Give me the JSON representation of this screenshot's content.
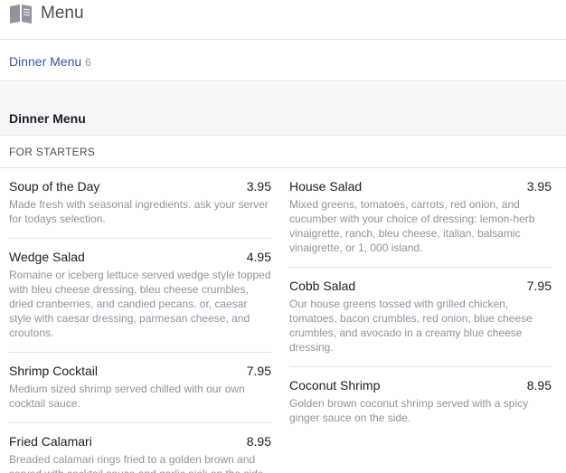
{
  "header": {
    "title": "Menu",
    "icon": "book-icon"
  },
  "tabs": [
    {
      "label": "Dinner Menu",
      "count": "6"
    }
  ],
  "section": {
    "title": "Dinner Menu",
    "subtitle": "FOR STARTERS"
  },
  "left_items": [
    {
      "name": "Soup of the Day",
      "price": "3.95",
      "desc": "Made fresh with seasonal ingredients. ask your server for todays selection."
    },
    {
      "name": "Wedge Salad",
      "price": "4.95",
      "desc": "Romaine or iceberg lettuce served wedge style topped with bleu cheese dressing, bleu cheese crumbles, dried cranberries, and candied pecans. or, caesar style with caesar dressing, parmesan cheese, and croutons."
    },
    {
      "name": "Shrimp Cocktail",
      "price": "7.95",
      "desc": "Medium sized shrimp served chilled with our own cocktail sauce."
    },
    {
      "name": "Fried Calamari",
      "price": "8.95",
      "desc": "Breaded calamari rings fried to a golden brown and served with cocktail sauce and garlic aioli on the side."
    }
  ],
  "right_items": [
    {
      "name": "House Salad",
      "price": "3.95",
      "desc": "Mixed greens, tomatoes, carrots, red onion, and cucumber with your choice of dressing: lemon-herb vinaigrette, ranch, bleu cheese, italian, balsamic vinaigrette, or 1, 000 island."
    },
    {
      "name": "Cobb Salad",
      "price": "7.95",
      "desc": "Our house greens tossed with grilled chicken, tomatoes, bacon crumbles, red onion, blue cheese crumbles, and avocado in a creamy blue cheese dressing."
    },
    {
      "name": "Coconut Shrimp",
      "price": "8.95",
      "desc": "Golden brown coconut shrimp served with a spicy ginger sauce on the side."
    }
  ]
}
